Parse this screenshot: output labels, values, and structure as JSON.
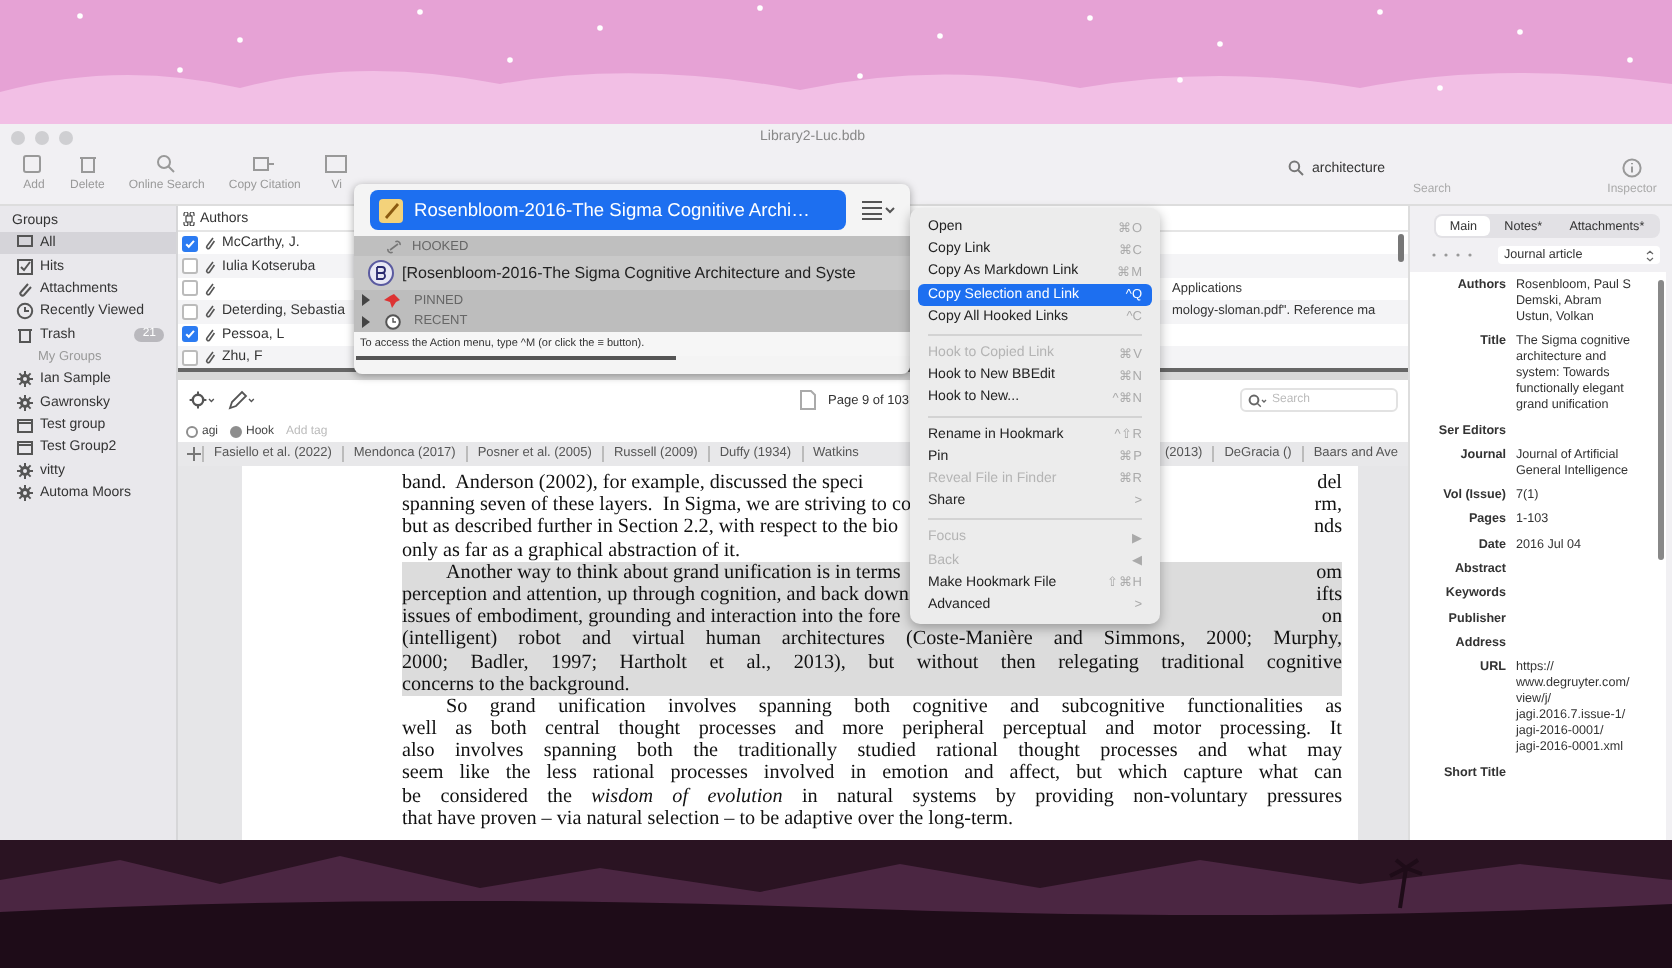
{
  "window": {
    "title": "Library2-Luc.bdb"
  },
  "toolbar": {
    "buttons": [
      {
        "label": "Add",
        "kind": "add"
      },
      {
        "label": "Delete",
        "kind": "delete"
      },
      {
        "label": "Online Search",
        "kind": "search"
      },
      {
        "label": "Copy Citation",
        "kind": "copy"
      },
      {
        "label": "Vi",
        "kind": "view"
      }
    ],
    "search": {
      "value": "architecture",
      "label": "Search"
    },
    "inspector_label": "Inspector"
  },
  "sidebar": {
    "header": "Groups",
    "items": [
      {
        "label": "All",
        "kind": "library",
        "selected": true
      },
      {
        "label": "Hits",
        "kind": "smart",
        "selected": false
      },
      {
        "label": "Attachments",
        "kind": "attachments",
        "selected": false
      },
      {
        "label": "Recently Viewed",
        "kind": "history",
        "selected": false
      },
      {
        "label": "Trash",
        "kind": "trash",
        "selected": false,
        "badge": "21"
      }
    ],
    "section": "My Groups",
    "groups": [
      {
        "label": "Ian Sample",
        "kind": "smart_group",
        "selected": false
      },
      {
        "label": "Gawronsky",
        "kind": "smart_group",
        "selected": false
      },
      {
        "label": "Test group",
        "kind": "static_group",
        "selected": false
      },
      {
        "label": "Test Group2",
        "kind": "static_group",
        "selected": false
      },
      {
        "label": "vitty",
        "kind": "smart_group",
        "selected": false
      },
      {
        "label": "Automa Moors",
        "kind": "smart_group",
        "selected": false
      }
    ]
  },
  "table": {
    "columns": [
      "Authors"
    ],
    "rows": [
      {
        "author": "McCarthy, J.",
        "checked": true
      },
      {
        "author": "Iulia Kotseruba",
        "checked": false
      },
      {
        "author": "",
        "checked": false,
        "column_2": "Applications"
      },
      {
        "author": "Deterding, Sebastia",
        "checked": false,
        "column_2": "mology-sloman.pdf\". Reference ma"
      },
      {
        "author": "Pessoa, L",
        "checked": true
      },
      {
        "author": "Zhu, F",
        "checked": false
      }
    ]
  },
  "pdf_toolbar": {
    "page": "Page 9 of 103",
    "search_placeholder": "Search"
  },
  "tags": [
    {
      "label": "agi",
      "color": "#ffffff"
    },
    {
      "label": "Hook",
      "color": "#8e8e8e"
    }
  ],
  "add_tag_placeholder": "Add tag",
  "citations_left": [
    "Fasiello et al. (2022)",
    "Mendonca (2017)",
    "Posner et al. (2005)",
    "Russell (2009)",
    "Duffy (1934)",
    "Watkins"
  ],
  "citations_right": [
    "(2013)",
    "DeGracia ()",
    "Baars and Ave"
  ],
  "document": {
    "lines": [
      {
        "left": "band.  Anderson (2002), for example, discussed the speci",
        "right": "del",
        "highlighted": false
      },
      {
        "left": "spanning seven of these layers.  In Sigma, we are striving to co",
        "right": "rm,",
        "highlighted": false
      },
      {
        "left": "but as described further in Section 2.2, with respect to the bio",
        "right": "nds",
        "highlighted": false
      },
      {
        "text": "only as far as a graphical abstraction of it.",
        "last": true,
        "highlighted": false
      },
      {
        "left": "Another way to think about grand unification is in terms",
        "right": "om",
        "indent": true,
        "highlighted": true
      },
      {
        "left": "perception and attention, up through cognition, and back down",
        "right": "ifts",
        "highlighted": true
      },
      {
        "left": "issues of embodiment, grounding and interaction into the fore",
        "right": "on",
        "highlighted": true
      },
      {
        "text": "(intelligent) robot and virtual human architectures (Coste-Manière and Simmons, 2000; Murphy,",
        "highlighted": true
      },
      {
        "text": "2000; Badler, 1997; Hartholt et al., 2013), but without then relegating traditional cognitive",
        "highlighted": true
      },
      {
        "text": "concerns to the background.",
        "last": true,
        "highlighted": true
      },
      {
        "text": "So grand unification involves spanning both cognitive and subcognitive functionalities as",
        "indent": true,
        "highlighted": false
      },
      {
        "text": "well as both central thought processes and more peripheral perceptual and motor processing.  It",
        "highlighted": false
      },
      {
        "text": "also involves spanning both the traditionally studied rational thought processes and what may",
        "highlighted": false
      },
      {
        "text": "seem like the less rational processes involved in emotion and affect, but which capture what can",
        "highlighted": false
      },
      {
        "text": "be considered the *wisdom of evolution* in natural systems by providing non-voluntary pressures",
        "highlighted": false
      },
      {
        "text": "that have proven – via natural selection – to be adaptive over the long-term.",
        "last": true,
        "highlighted": false
      }
    ]
  },
  "inspector": {
    "tabs": [
      {
        "label": "Main",
        "selected": true
      },
      {
        "label": "Notes*",
        "selected": false
      },
      {
        "label": "Attachments*",
        "selected": false
      }
    ],
    "type": "Journal article",
    "fields": [
      {
        "label": "Authors",
        "value": "Rosenbloom, Paul S\nDemski, Abram\nUstun, Volkan"
      },
      {
        "label": "Title",
        "value": "The Sigma cognitive architecture and system: Towards functionally elegant grand unification"
      },
      {
        "label": "Ser Editors"
      },
      {
        "label": "Journal",
        "value": "Journal of Artificial General Intelligence"
      },
      {
        "label": "Vol (Issue)",
        "value": "7(1)"
      },
      {
        "label": "Pages",
        "value": "1-103"
      },
      {
        "label": "Date",
        "value": "2016 Jul 04"
      },
      {
        "label": "Abstract"
      },
      {
        "label": "Keywords"
      },
      {
        "label": "Publisher"
      },
      {
        "label": "Address"
      },
      {
        "label": "URL",
        "value": "https://\nwww.degruyter.com/\nview/j/\njagi.2016.7.issue-1/\njagi-2016-0001/\njagi-2016-0001.xml"
      },
      {
        "label": "Short Title"
      }
    ]
  },
  "hook_window": {
    "title": "Rosenbloom-2016-The Sigma Cognitive Archi…",
    "hooked_header": "HOOKED",
    "hooked": [
      {
        "title": "[Rosenbloom-2016-The Sigma Cognitive Architecture and Syste"
      }
    ],
    "sections": [
      {
        "label": "PINNED",
        "kind": "pinned",
        "expanded": false
      },
      {
        "label": "RECENT",
        "kind": "recent",
        "expanded": false
      }
    ],
    "hint": "To access the Action menu, type ^M (or click the ≡ button)."
  },
  "context_menu": {
    "items": [
      {
        "kind": "item",
        "label": "Open",
        "shortcut": "⌘O",
        "disabled": false,
        "selected": false
      },
      {
        "kind": "item",
        "label": "Copy Link",
        "shortcut": "⌘C",
        "disabled": false,
        "selected": false
      },
      {
        "kind": "item",
        "label": "Copy As Markdown Link",
        "shortcut": "⌘M",
        "disabled": false,
        "selected": false
      },
      {
        "kind": "item",
        "label": "Copy Selection and Link",
        "shortcut": "^Q",
        "disabled": false,
        "selected": true
      },
      {
        "kind": "item",
        "label": "Copy All Hooked Links",
        "shortcut": "^C",
        "disabled": false,
        "selected": false
      },
      {
        "kind": "separator"
      },
      {
        "kind": "item",
        "label": "Hook to Copied Link",
        "shortcut": "⌘V",
        "disabled": true,
        "selected": false
      },
      {
        "kind": "item",
        "label": "Hook to New BBEdit",
        "shortcut": "⌘N",
        "disabled": false,
        "selected": false
      },
      {
        "kind": "item",
        "label": "Hook to New...",
        "shortcut": "^⌘N",
        "disabled": false,
        "selected": false
      },
      {
        "kind": "separator"
      },
      {
        "kind": "item",
        "label": "Rename in Hookmark",
        "shortcut": "^⇧R",
        "disabled": false,
        "selected": false
      },
      {
        "kind": "item",
        "label": "Pin",
        "shortcut": "⌘P",
        "disabled": false,
        "selected": false
      },
      {
        "kind": "item",
        "label": "Reveal File in Finder",
        "shortcut": "⌘R",
        "disabled": true,
        "selected": false
      },
      {
        "kind": "item",
        "label": "Share",
        "shortcut": ">",
        "disabled": false,
        "selected": false
      },
      {
        "kind": "separator"
      },
      {
        "kind": "item",
        "label": "Focus",
        "shortcut": "▶",
        "disabled": true,
        "selected": false
      },
      {
        "kind": "item",
        "label": "Back",
        "shortcut": "◀",
        "disabled": true,
        "selected": false
      },
      {
        "kind": "item",
        "label": "Make Hookmark File",
        "shortcut": "⇧⌘H",
        "disabled": false,
        "selected": false
      },
      {
        "kind": "item",
        "label": "Advanced",
        "shortcut": ">",
        "disabled": false,
        "selected": false
      }
    ]
  }
}
